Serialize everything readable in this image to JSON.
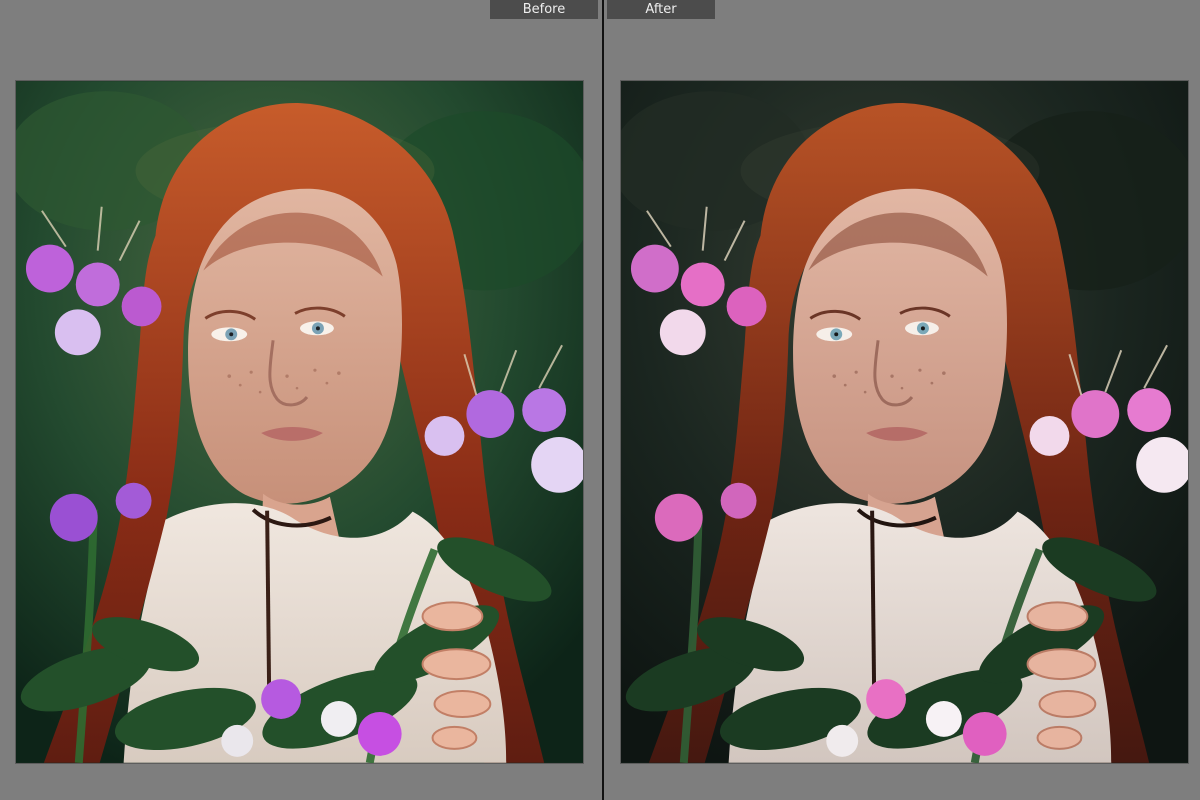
{
  "labels": {
    "before": "Before",
    "after": "After"
  },
  "colors": {
    "background": "#7e7e7e",
    "divider": "#111111",
    "label_background": "#4c4c4c",
    "label_text": "#eeeeee"
  },
  "icons": {
    "before_photo": "portrait-photo-icon",
    "after_photo": "portrait-photo-icon"
  }
}
